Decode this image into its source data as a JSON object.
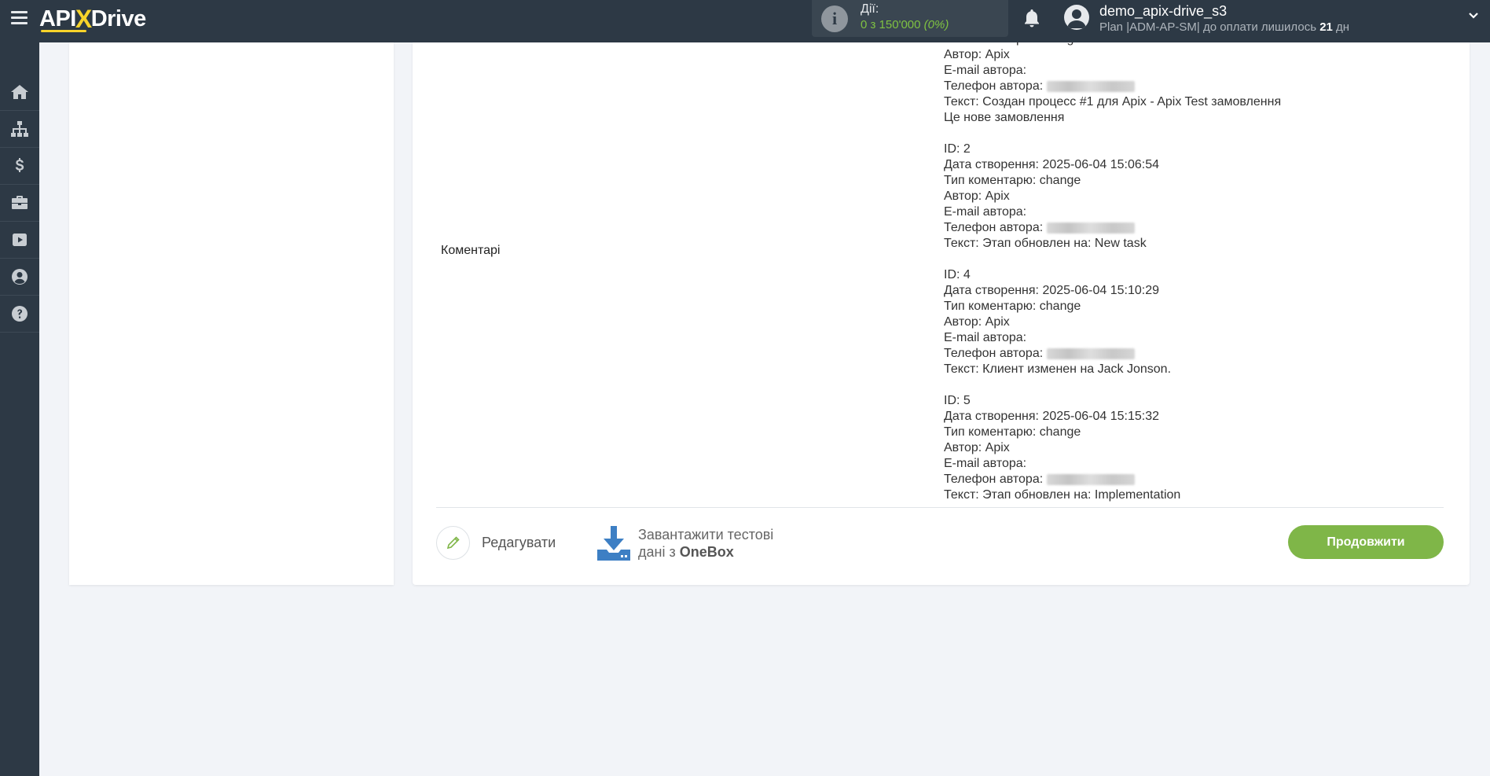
{
  "header": {
    "logo_part1": "API",
    "logo_x": "X",
    "logo_part2": "Drive",
    "actions_label": "Дії:",
    "actions_count": "0 з 150'000",
    "actions_percent": "(0%)",
    "username": "demo_apix-drive_s3",
    "plan_prefix": "Plan |ADM-AP-SM| до оплати лишилось ",
    "plan_days": "21",
    "plan_suffix": " дн"
  },
  "sidebar": {
    "items": [
      "home-icon",
      "sitemap-icon",
      "dollar-icon",
      "briefcase-icon",
      "youtube-icon",
      "user-icon",
      "help-icon"
    ]
  },
  "field": {
    "label": "Коментарі",
    "lines": [
      "Тип коментарю: change",
      "Автор: Apix",
      "E-mail автора:",
      "Телефон автора:",
      "Текст: Создан процесс #1 для Apix - Apix Test замовлення",
      "Це нове замовлення",
      "",
      "ID: 2",
      "Дата створення: 2025-06-04 15:06:54",
      "Тип коментарю: change",
      "Автор: Apix",
      "E-mail автора:",
      "Телефон автора:",
      "Текст: Этап обновлен на: New task",
      "",
      "ID: 4",
      "Дата створення: 2025-06-04 15:10:29",
      "Тип коментарю: change",
      "Автор: Apix",
      "E-mail автора:",
      "Телефон автора:",
      "Текст: Клиент изменен на Jack Jonson.",
      "",
      "ID: 5",
      "Дата створення: 2025-06-04 15:15:32",
      "Тип коментарю: change",
      "Автор: Apix",
      "E-mail автора:",
      "Телефон автора:",
      "Текст: Этап обновлен на: Implementation"
    ]
  },
  "footer": {
    "edit_label": "Редагувати",
    "load_line1": "Завантажити тестові",
    "load_line2_prefix": "дані з ",
    "load_service": "OneBox",
    "continue_label": "Продовжити"
  },
  "colors": {
    "topbar": "#2d3945",
    "accent_yellow": "#f7d32a",
    "green": "#7fb648",
    "download_blue": "#3d7fc4"
  }
}
